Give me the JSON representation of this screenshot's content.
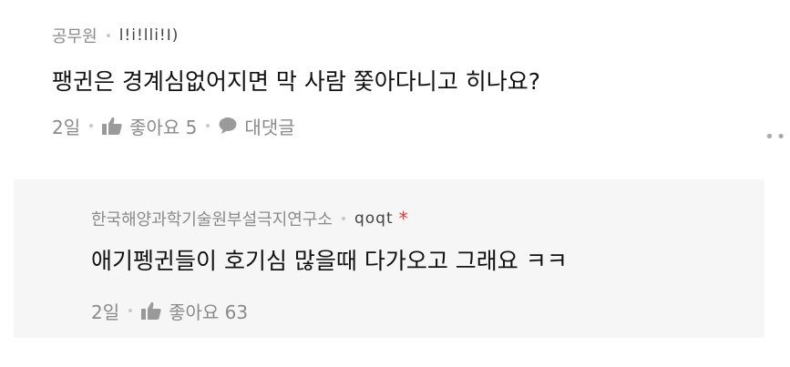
{
  "comment": {
    "author": "공무원",
    "nickname": "l!i!lli!I)",
    "text": "팽귄은 경계심없어지면 막 사람 쫓아다니고 히나요?",
    "time": "2일",
    "like_label": "좋아요 5",
    "reply_label": "대댓글",
    "more_label": "•••"
  },
  "reply": {
    "author": "한국해양과학기술원부설극지연구소",
    "nickname": "qoqt",
    "badge": "*",
    "text": "애기펭귄들이 호기심 많을때 다가오고 그래요 ㅋㅋ",
    "time": "2일",
    "like_label": "좋아요 63"
  },
  "colors": {
    "reply_background": "#f6f6f6",
    "badge": "#ee3333",
    "muted": "#8a8a8a"
  }
}
